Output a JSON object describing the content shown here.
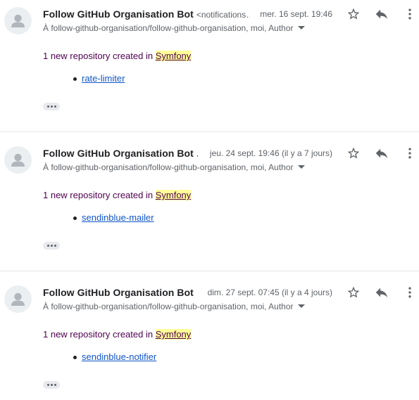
{
  "messages": [
    {
      "sender_name": "Follow GitHub Organisation Bot",
      "sender_email": "<notifications…",
      "date": "mer. 16 sept. 19:46",
      "recipients": "À follow-github-organisation/follow-github-organisation, moi, Author",
      "body_prefix": "1 new repository created in ",
      "org_name": "Symfony",
      "repo": "rate-limiter"
    },
    {
      "sender_name": "Follow GitHub Organisation Bot …",
      "sender_email": "",
      "date": "jeu. 24 sept. 19:46 (il y a 7 jours)",
      "recipients": "À follow-github-organisation/follow-github-organisation, moi, Author",
      "body_prefix": "1 new repository created in ",
      "org_name": "Symfony",
      "repo": "sendinblue-mailer"
    },
    {
      "sender_name": "Follow GitHub Organisation Bot …",
      "sender_email": "",
      "date": "dim. 27 sept. 07:45 (il y a 4 jours)",
      "recipients": "À follow-github-organisation/follow-github-organisation, moi, Author",
      "body_prefix": "1 new repository created in ",
      "org_name": "Symfony",
      "repo": "sendinblue-notifier"
    }
  ],
  "icons": {
    "avatar": "default-avatar-icon",
    "star": "star-outline-icon",
    "reply": "reply-icon",
    "more": "more-vertical-icon",
    "expand": "caret-down-icon",
    "trimmed": "ellipsis-icon"
  },
  "colors": {
    "visited_text": "#500050",
    "link": "#1155cc",
    "highlight": "#ffff99",
    "secondary_text": "#5f6368"
  }
}
